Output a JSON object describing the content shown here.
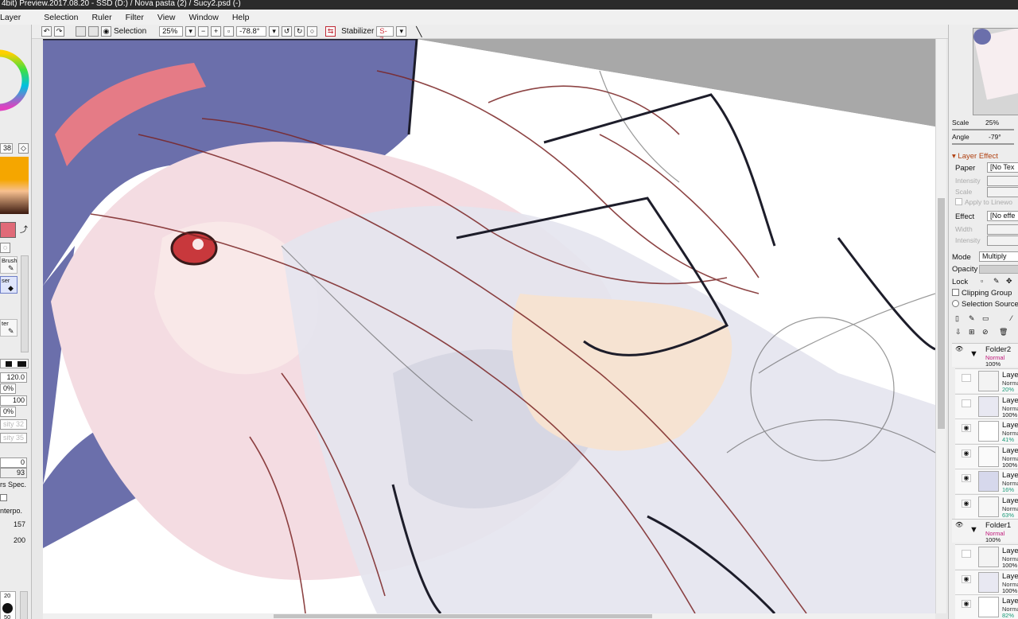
{
  "window": {
    "title": "4bit) Preview.2017.08.20 - SSD (D:) / Nova pasta (2) / Sucy2.psd (-)"
  },
  "menu": [
    "Layer",
    "Selection",
    "Ruler",
    "Filter",
    "View",
    "Window",
    "Help"
  ],
  "toolbar": {
    "selection_label": "Selection",
    "zoom_value": "25%",
    "rotation_value": "-78.8°",
    "stabilizer_label": "Stabilizer",
    "stabilizer_value": "S-7"
  },
  "left_panel": {
    "brush_size": "38",
    "brush_label": "Brush",
    "eraser_label": "ser",
    "blur_label": "ter",
    "size_value": "120.0",
    "min_size": "0%",
    "density": "100",
    "min_density": "0%",
    "intensity_label": "sity 32",
    "intensity2_label": "sity 35",
    "val_0": "0",
    "val_93": "93",
    "spec_label": "rs Spec.",
    "interp_label": "nterpo.",
    "val_157": "157",
    "val_200": "200",
    "dot_20": "20",
    "dot_50": "50"
  },
  "navigator": {
    "scale_label": "Scale",
    "scale_value": "25%",
    "angle_label": "Angle",
    "angle_value": "-79°"
  },
  "layer_effect": {
    "header": "Layer Effect",
    "paper_label": "Paper",
    "paper_value": "[No Tex",
    "intensity_label": "Intensity",
    "scale_label": "Scale",
    "apply_label": "Apply to Linewo",
    "effect_label": "Effect",
    "effect_value": "[No effe",
    "width_label": "Width",
    "intensity2_label": "Intensity"
  },
  "layer_props": {
    "mode_label": "Mode",
    "mode_value": "Multiply",
    "opacity_label": "Opacity",
    "lock_label": "Lock",
    "clipping_label": "Clipping Group",
    "selection_source_label": "Selection Source"
  },
  "layers": {
    "folder2": {
      "name": "Folder2",
      "mode": "Normal",
      "opacity": "100%"
    },
    "items_a": [
      {
        "name": "Layer",
        "mode": "Norma",
        "opacity": "20%",
        "eye": false,
        "op_color": "#1a9a78"
      },
      {
        "name": "Layer",
        "mode": "Norma",
        "opacity": "100%",
        "eye": false,
        "op_color": "#111111"
      },
      {
        "name": "Layer",
        "mode": "Norma",
        "opacity": "41%",
        "eye": true,
        "op_color": "#1a9a78"
      },
      {
        "name": "Layer",
        "mode": "Norma",
        "opacity": "100%",
        "eye": true,
        "op_color": "#111111"
      },
      {
        "name": "Layer",
        "mode": "Norma",
        "opacity": "16%",
        "eye": true,
        "op_color": "#1a9a78"
      },
      {
        "name": "Layer",
        "mode": "Norma",
        "opacity": "63%",
        "eye": true,
        "op_color": "#1a9a78"
      }
    ],
    "folder1": {
      "name": "Folder1",
      "mode": "Normal",
      "opacity": "100%"
    },
    "items_b": [
      {
        "name": "Layer",
        "mode": "Norma",
        "opacity": "100%",
        "eye": false,
        "op_color": "#111111"
      },
      {
        "name": "Layer",
        "mode": "Norma",
        "opacity": "100%",
        "eye": true,
        "op_color": "#111111"
      },
      {
        "name": "Layer",
        "mode": "Norma",
        "opacity": "82%",
        "eye": true,
        "op_color": "#1a9a78"
      }
    ]
  }
}
